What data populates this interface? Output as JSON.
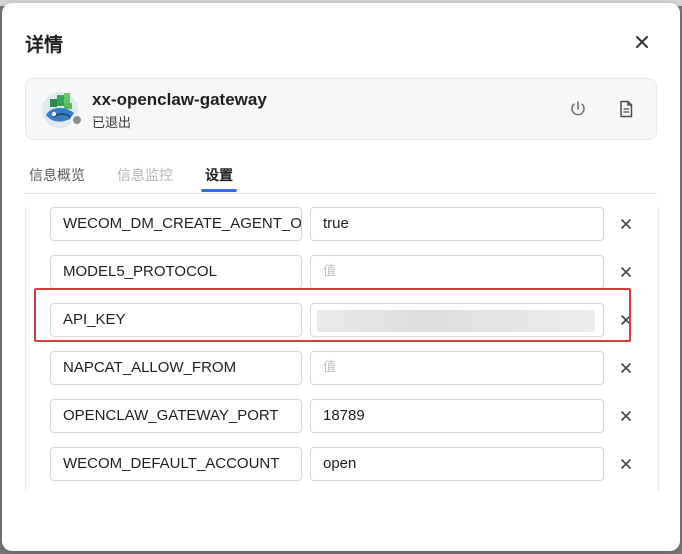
{
  "dialog": {
    "title": "详情"
  },
  "app": {
    "name": "xx-openclaw-gateway",
    "status": "已退出",
    "status_color": "#8c8c8c"
  },
  "tabs": [
    {
      "label": "信息概览",
      "active": false
    },
    {
      "label": "信息监控",
      "active": false,
      "disabled": true
    },
    {
      "label": "设置",
      "active": true
    }
  ],
  "accent_color": "#2f6fed",
  "highlight_color": "#d63a3a",
  "env_vars": [
    {
      "key": "WECOM_DM_CREATE_AGENT_ON",
      "value": "true",
      "placeholder": "值"
    },
    {
      "key": "MODEL5_PROTOCOL",
      "value": "",
      "placeholder": "值"
    },
    {
      "key": "API_KEY",
      "value": "",
      "placeholder": "",
      "blurred": true
    },
    {
      "key": "NAPCAT_ALLOW_FROM",
      "value": "",
      "placeholder": "值"
    },
    {
      "key": "OPENCLAW_GATEWAY_PORT",
      "value": "18789",
      "placeholder": "值"
    },
    {
      "key": "WECOM_DEFAULT_ACCOUNT",
      "value": "open",
      "placeholder": "值"
    }
  ],
  "icons": {
    "close": "close-icon",
    "power": "power-icon",
    "document": "document-icon",
    "remove": "close-icon",
    "logo": "app-logo-icon"
  }
}
